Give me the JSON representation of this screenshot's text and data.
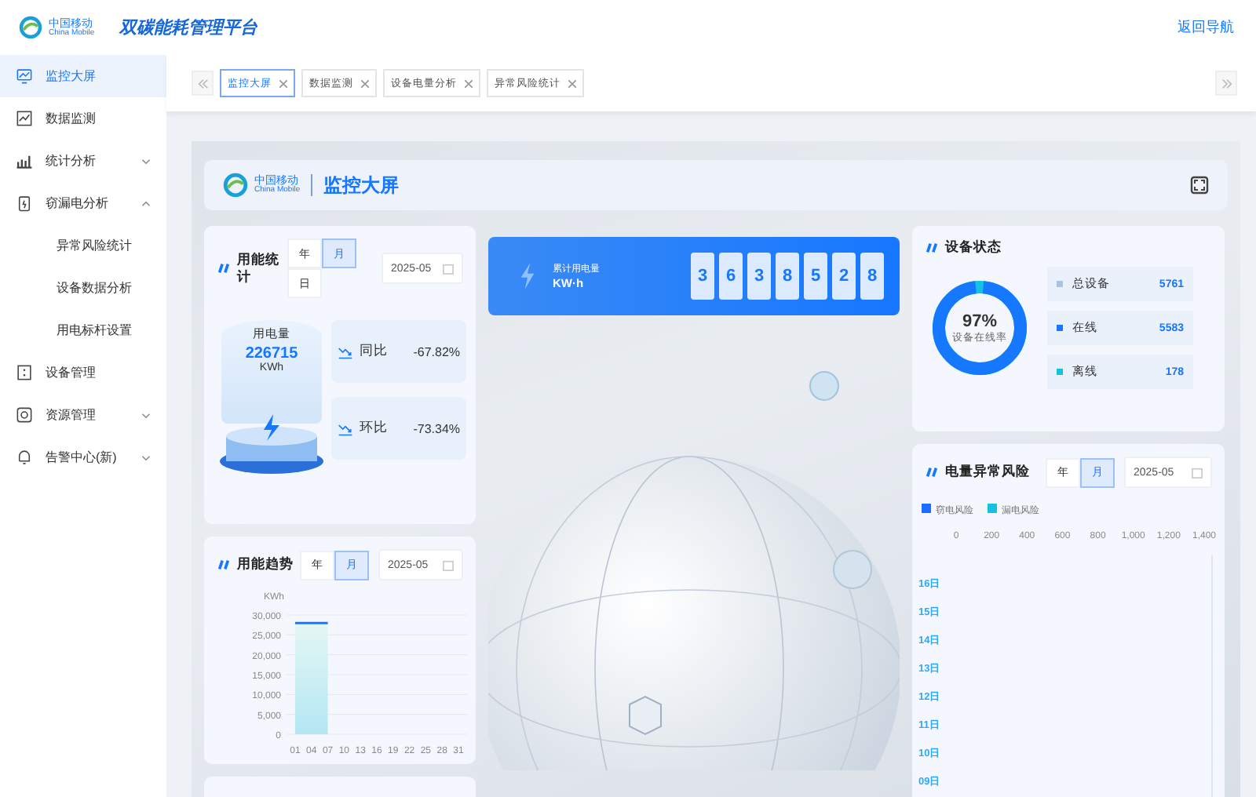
{
  "header": {
    "brand_cn": "中国移动",
    "brand_en": "China Mobile",
    "title": "双碳能耗管理平台",
    "back_link": "返回导航"
  },
  "sidebar": {
    "items": [
      {
        "label": "监控大屏",
        "selected": true
      },
      {
        "label": "数据监测",
        "selected": false
      },
      {
        "label": "统计分析",
        "selected": false,
        "expanded": false
      },
      {
        "label": "窃漏电分析",
        "selected": false,
        "expanded": true,
        "children": [
          {
            "label": "异常风险统计",
            "selected": false
          },
          {
            "label": "设备数据分析",
            "selected": false
          },
          {
            "label": "用电标杆设置",
            "selected": false
          }
        ]
      },
      {
        "label": "设备管理",
        "selected": false
      },
      {
        "label": "资源管理",
        "selected": false,
        "expanded": false
      },
      {
        "label": "告警中心(新)",
        "selected": false,
        "expanded": false
      }
    ]
  },
  "tabs": [
    {
      "label": "监控大屏",
      "selected": true
    },
    {
      "label": "数据监测",
      "selected": false
    },
    {
      "label": "设备电量分析",
      "selected": false
    },
    {
      "label": "异常风险统计",
      "selected": false
    }
  ],
  "dashboard": {
    "brand_cn": "中国移动",
    "brand_en": "China Mobile",
    "title": "监控大屏",
    "energy_stats": {
      "title": "用能统计",
      "periods": [
        {
          "label": "年",
          "selected": false
        },
        {
          "label": "月",
          "selected": true
        },
        {
          "label": "日",
          "selected": false
        }
      ],
      "date": "2025-05",
      "usage_label": "用电量",
      "usage_value": "226715",
      "usage_unit": "KWh",
      "comparisons": [
        {
          "label": "同比",
          "value": "-67.82%"
        },
        {
          "label": "环比",
          "value": "-73.34%"
        }
      ]
    },
    "energy_trend": {
      "title": "用能趋势",
      "periods": [
        {
          "label": "年",
          "selected": false
        },
        {
          "label": "月",
          "selected": true
        }
      ],
      "date": "2025-05",
      "chart_data": {
        "type": "area",
        "ylabel": "KWh",
        "categories": [
          "01",
          "04",
          "07",
          "10",
          "13",
          "16",
          "19",
          "22",
          "25",
          "28",
          "31"
        ],
        "series": [
          {
            "color": "#1677ff",
            "values": [
              28000,
              28000,
              28000,
              null,
              null,
              null,
              null,
              null,
              null,
              null,
              null
            ]
          }
        ],
        "ylim": [
          0,
          30000
        ],
        "grid": true,
        "yticks": [
          {
            "value": 0,
            "label": "0"
          },
          {
            "value": 5000,
            "label": "5,000"
          },
          {
            "value": 10000,
            "label": "10,000"
          },
          {
            "value": 15000,
            "label": "15,000"
          },
          {
            "value": 20000,
            "label": "20,000"
          },
          {
            "value": 25000,
            "label": "25,000"
          },
          {
            "value": 30000,
            "label": "30,000"
          }
        ]
      }
    },
    "total_usage": {
      "label": "累计用电量",
      "unit": "KW·h",
      "digits": [
        "3",
        "6",
        "3",
        "8",
        "5",
        "2",
        "8"
      ]
    },
    "device_status": {
      "title": "设备状态",
      "rate": "97%",
      "rate_label": "设备在线率",
      "items": [
        {
          "label": "总设备",
          "value": "5761",
          "color": "#a9c3e6"
        },
        {
          "label": "在线",
          "value": "5583",
          "color": "#1677ff"
        },
        {
          "label": "离线",
          "value": "178",
          "color": "#13c2e0"
        }
      ]
    },
    "risk": {
      "title": "电量异常风险",
      "periods": [
        {
          "label": "年",
          "selected": false
        },
        {
          "label": "月",
          "selected": true
        }
      ],
      "date": "2025-05",
      "chart_data": {
        "type": "bar",
        "orientation": "horizontal",
        "categories": [
          "16日",
          "15日",
          "14日",
          "13日",
          "12日",
          "11日",
          "10日",
          "09日"
        ],
        "series": [
          {
            "name": "窃电风险",
            "color": "#1a6dff",
            "values": [
              null,
              null,
              null,
              null,
              null,
              null,
              null,
              null
            ]
          },
          {
            "name": "漏电风险",
            "color": "#13c2e0",
            "values": [
              null,
              null,
              null,
              null,
              null,
              null,
              null,
              null
            ]
          }
        ],
        "xlim": [
          0,
          1400
        ],
        "xticks": [
          {
            "value": 0,
            "label": "0"
          },
          {
            "value": 200,
            "label": "200"
          },
          {
            "value": 400,
            "label": "400"
          },
          {
            "value": 600,
            "label": "600"
          },
          {
            "value": 800,
            "label": "800"
          },
          {
            "value": 1000,
            "label": "1,000"
          },
          {
            "value": 1200,
            "label": "1,200"
          },
          {
            "value": 1400,
            "label": "1,400"
          }
        ]
      }
    }
  }
}
